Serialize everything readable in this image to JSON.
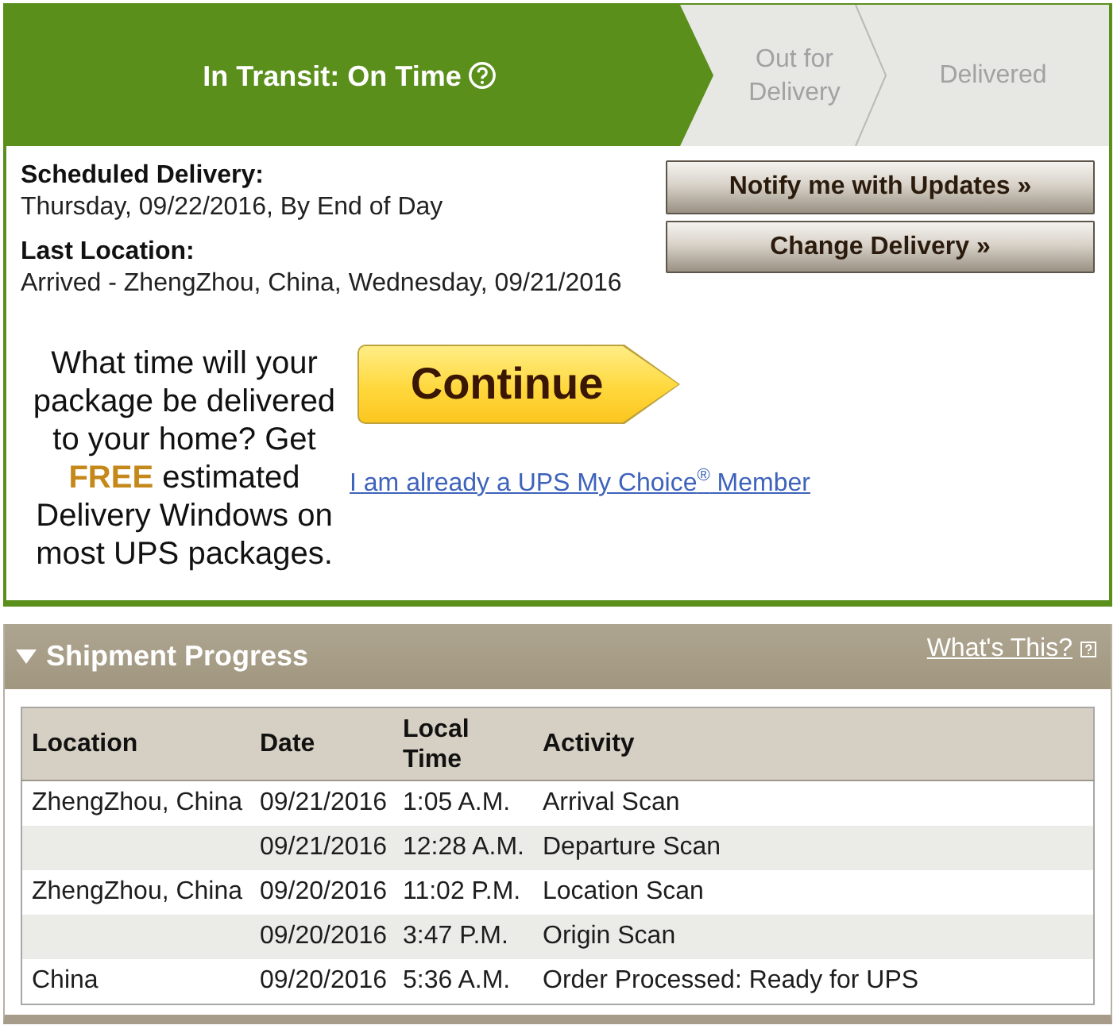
{
  "status_steps": [
    {
      "label": "In Transit: On Time",
      "selected": true,
      "help_icon": true
    },
    {
      "label": "Out for Delivery",
      "selected": false,
      "help_icon": false
    },
    {
      "label": "Delivered",
      "selected": false,
      "help_icon": false
    }
  ],
  "delivery_details": [
    {
      "label": "Scheduled Delivery:",
      "value": "Thursday, 09/22/2016, By End of Day"
    },
    {
      "label": "Last Location:",
      "value": "Arrived - ZhengZhou, China, Wednesday, 09/21/2016"
    }
  ],
  "actions": [
    "Notify me with Updates »",
    "Change Delivery »"
  ],
  "promo": {
    "text": "What time will your package be delivered to your home? Get **FREE** estimated Delivery Windows on most UPS packages.",
    "button": "Continue",
    "link": "I am already a UPS My Choice$^{®}$ Member"
  },
  "shipment_progress": {
    "title": "Shipment Progress",
    "expanded": true,
    "help_link": "What's This?",
    "table": {
      "columns": [
        "Location",
        "Date",
        "Local Time",
        "Activity"
      ],
      "rows": [
        {
          "location": "ZhengZhou, China",
          "date": "09/21/2016",
          "local_time": "1:05 A.M.",
          "activity": "Arrival Scan"
        },
        {
          "date": "09/21/2016",
          "local_time": "12:28 A.M.",
          "activity": "Departure Scan"
        },
        {
          "location": "ZhengZhou, China",
          "date": "09/20/2016",
          "local_time": "11:02 P.M.",
          "activity": "Location Scan"
        },
        {
          "date": "09/20/2016",
          "local_time": "3:47 P.M.",
          "activity": "Origin Scan"
        },
        {
          "location": "China",
          "date": "09/20/2016",
          "local_time": "5:36 A.M.",
          "activity": "Order Processed: Ready for UPS"
        }
      ]
    }
  }
}
